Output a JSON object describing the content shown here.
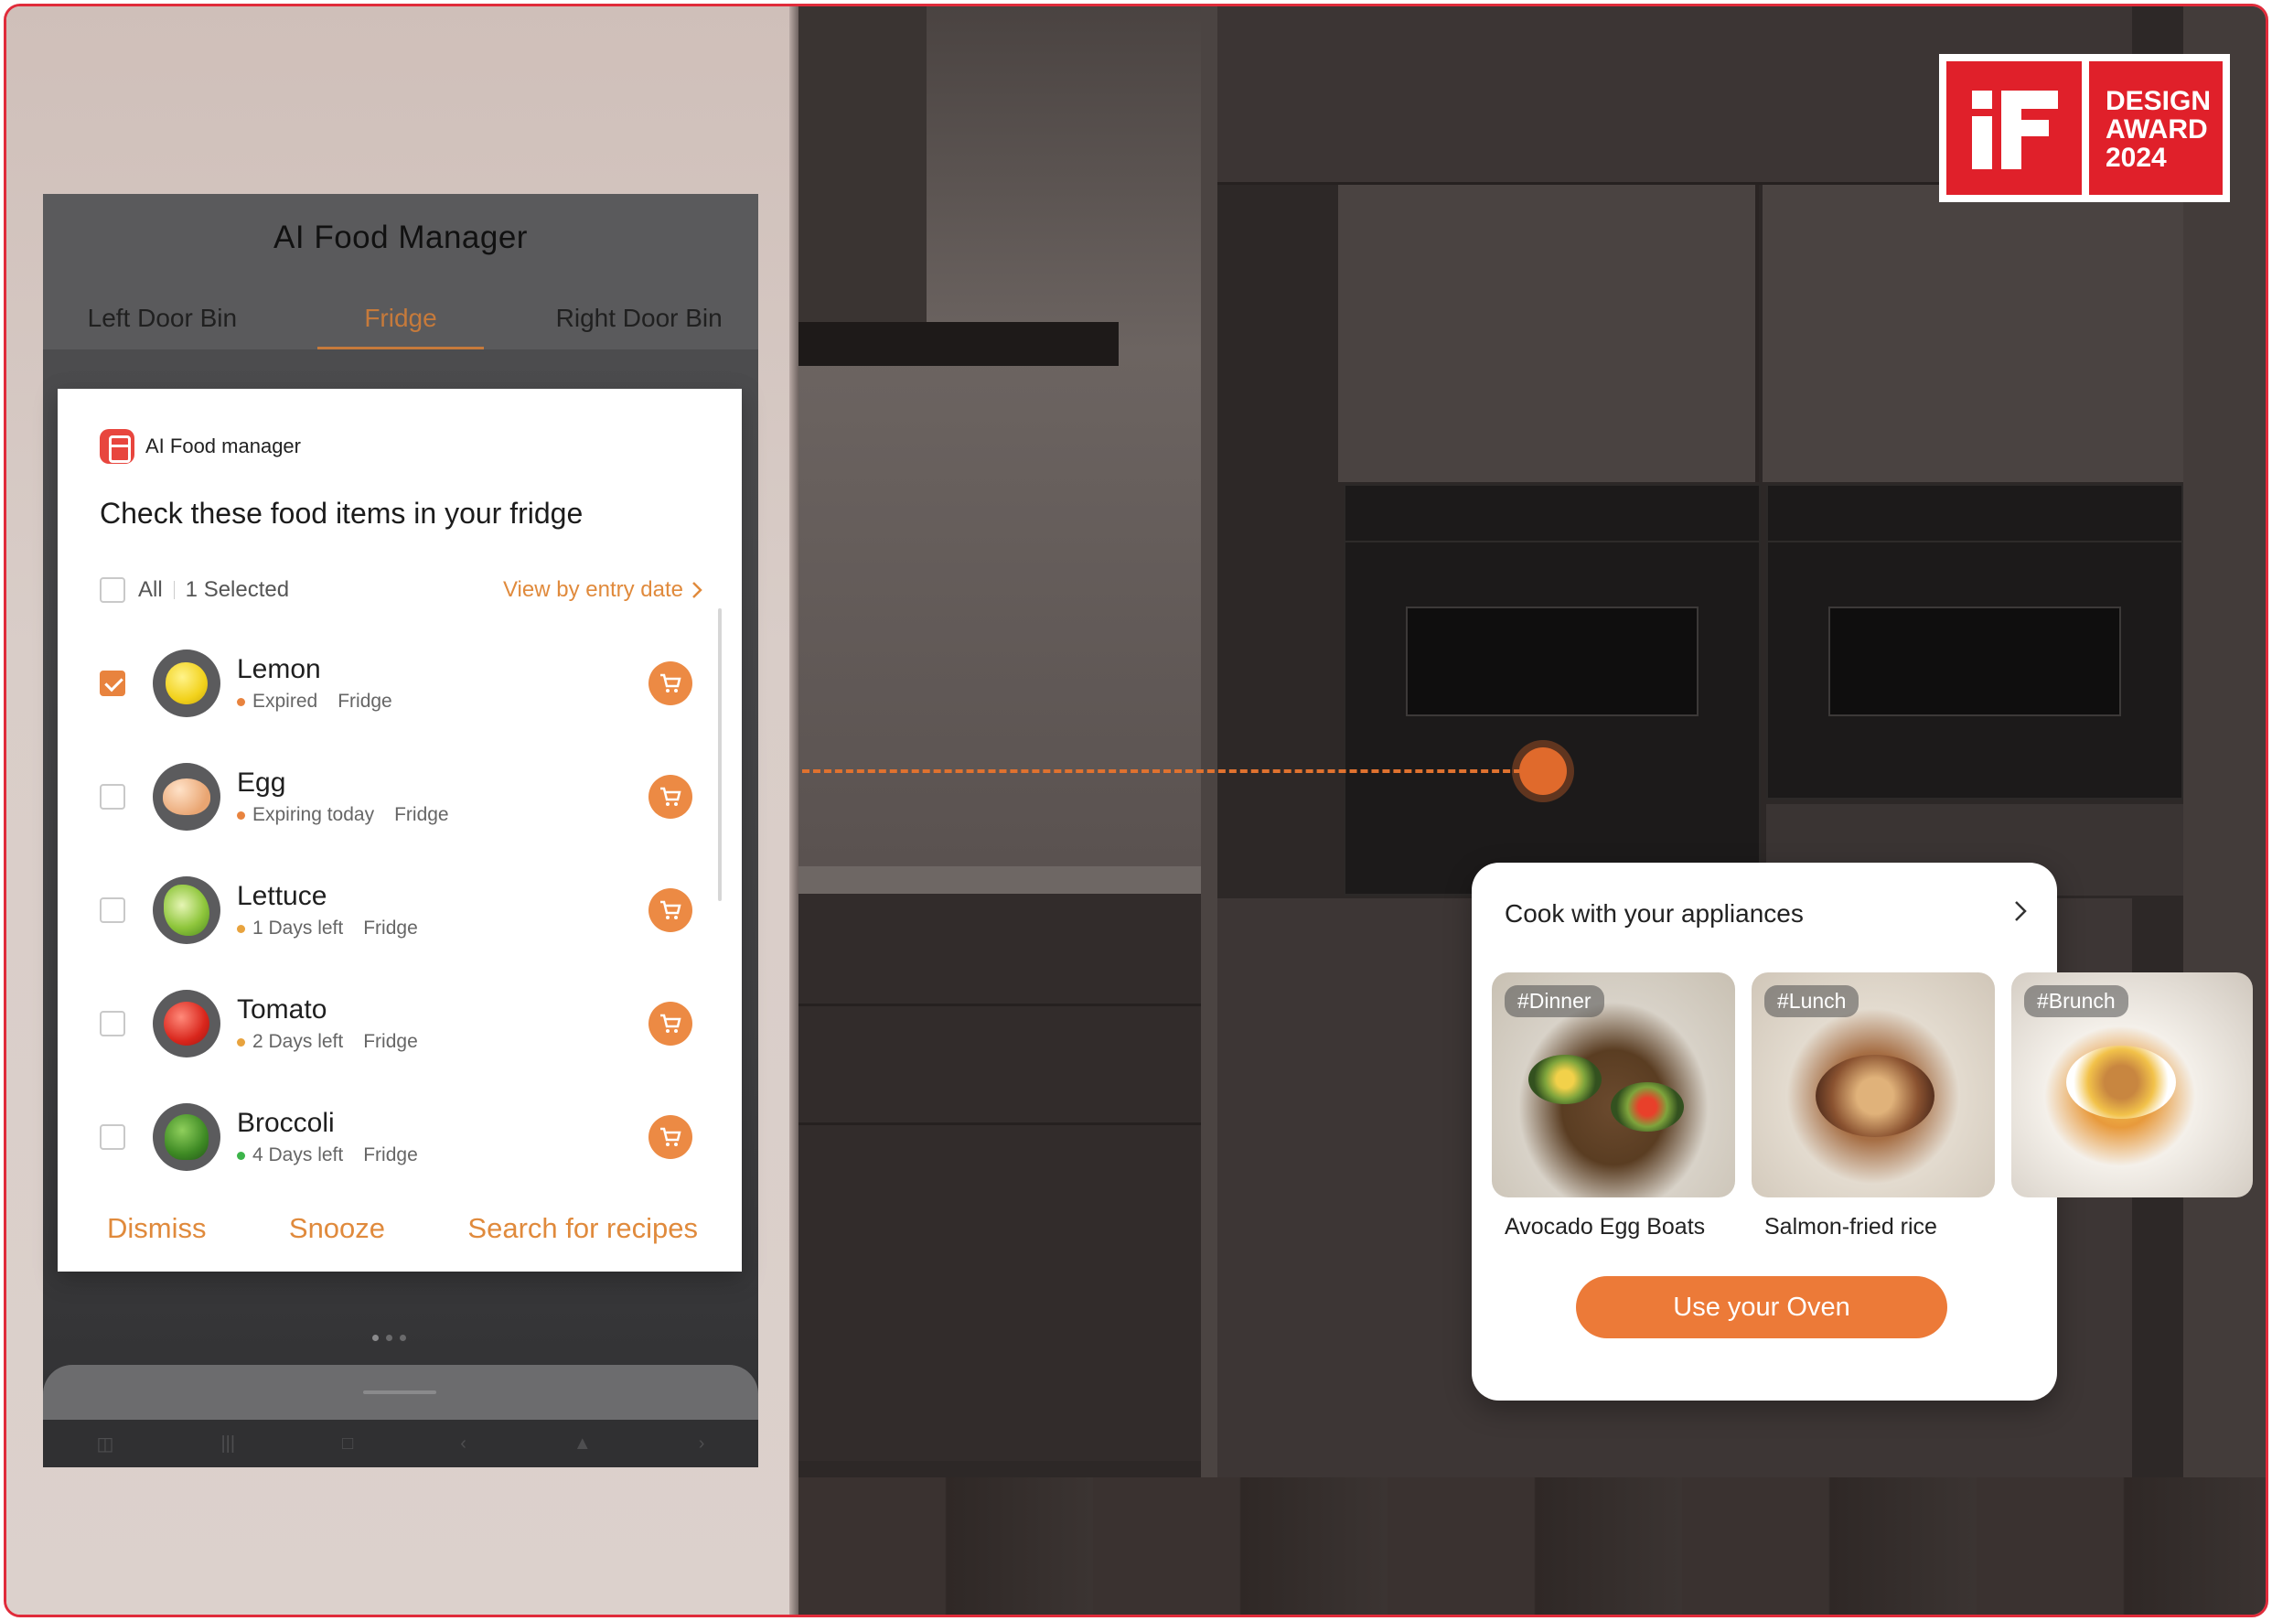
{
  "colors": {
    "accent": "#e08a3c",
    "button": "#ec7a38",
    "award_red": "#e0202a"
  },
  "tablet": {
    "title": "AI Food Manager",
    "tabs": [
      {
        "label": "Left Door Bin",
        "active": false
      },
      {
        "label": "Fridge",
        "active": true
      },
      {
        "label": "Right Door Bin",
        "active": false
      }
    ]
  },
  "notification": {
    "app_name": "AI Food manager",
    "heading": "Check  these food items in your fridge",
    "all_label": "All",
    "selected_label": "1 Selected",
    "view_by": "View by entry date",
    "items": [
      {
        "name": "Lemon",
        "status": "Expired",
        "status_color": "#e8833e",
        "location": "Fridge",
        "checked": true,
        "icon": "lemon-icon"
      },
      {
        "name": "Egg",
        "status": "Expiring today",
        "status_color": "#e8833e",
        "location": "Fridge",
        "checked": false,
        "icon": "egg-icon"
      },
      {
        "name": "Lettuce",
        "status": "1 Days left",
        "status_color": "#e8a33e",
        "location": "Fridge",
        "checked": false,
        "icon": "lettuce-icon"
      },
      {
        "name": "Tomato",
        "status": "2 Days left",
        "status_color": "#e8a33e",
        "location": "Fridge",
        "checked": false,
        "icon": "tomato-icon"
      },
      {
        "name": "Broccoli",
        "status": "4 Days left",
        "status_color": "#3cb44a",
        "location": "Fridge",
        "checked": false,
        "icon": "broccoli-icon"
      }
    ],
    "footer": {
      "dismiss": "Dismiss",
      "snooze": "Snooze",
      "search": "Search for recipes"
    }
  },
  "appliance_card": {
    "title": "Cook with your appliances",
    "recipes": [
      {
        "tag": "#Dinner",
        "name": "Avocado Egg Boats"
      },
      {
        "tag": "#Lunch",
        "name": "Salmon-fried rice"
      },
      {
        "tag": "#Brunch",
        "name": ""
      }
    ],
    "button": "Use your Oven"
  },
  "award": {
    "line1": "DESIGN",
    "line2": "AWARD",
    "line3": "2024"
  }
}
